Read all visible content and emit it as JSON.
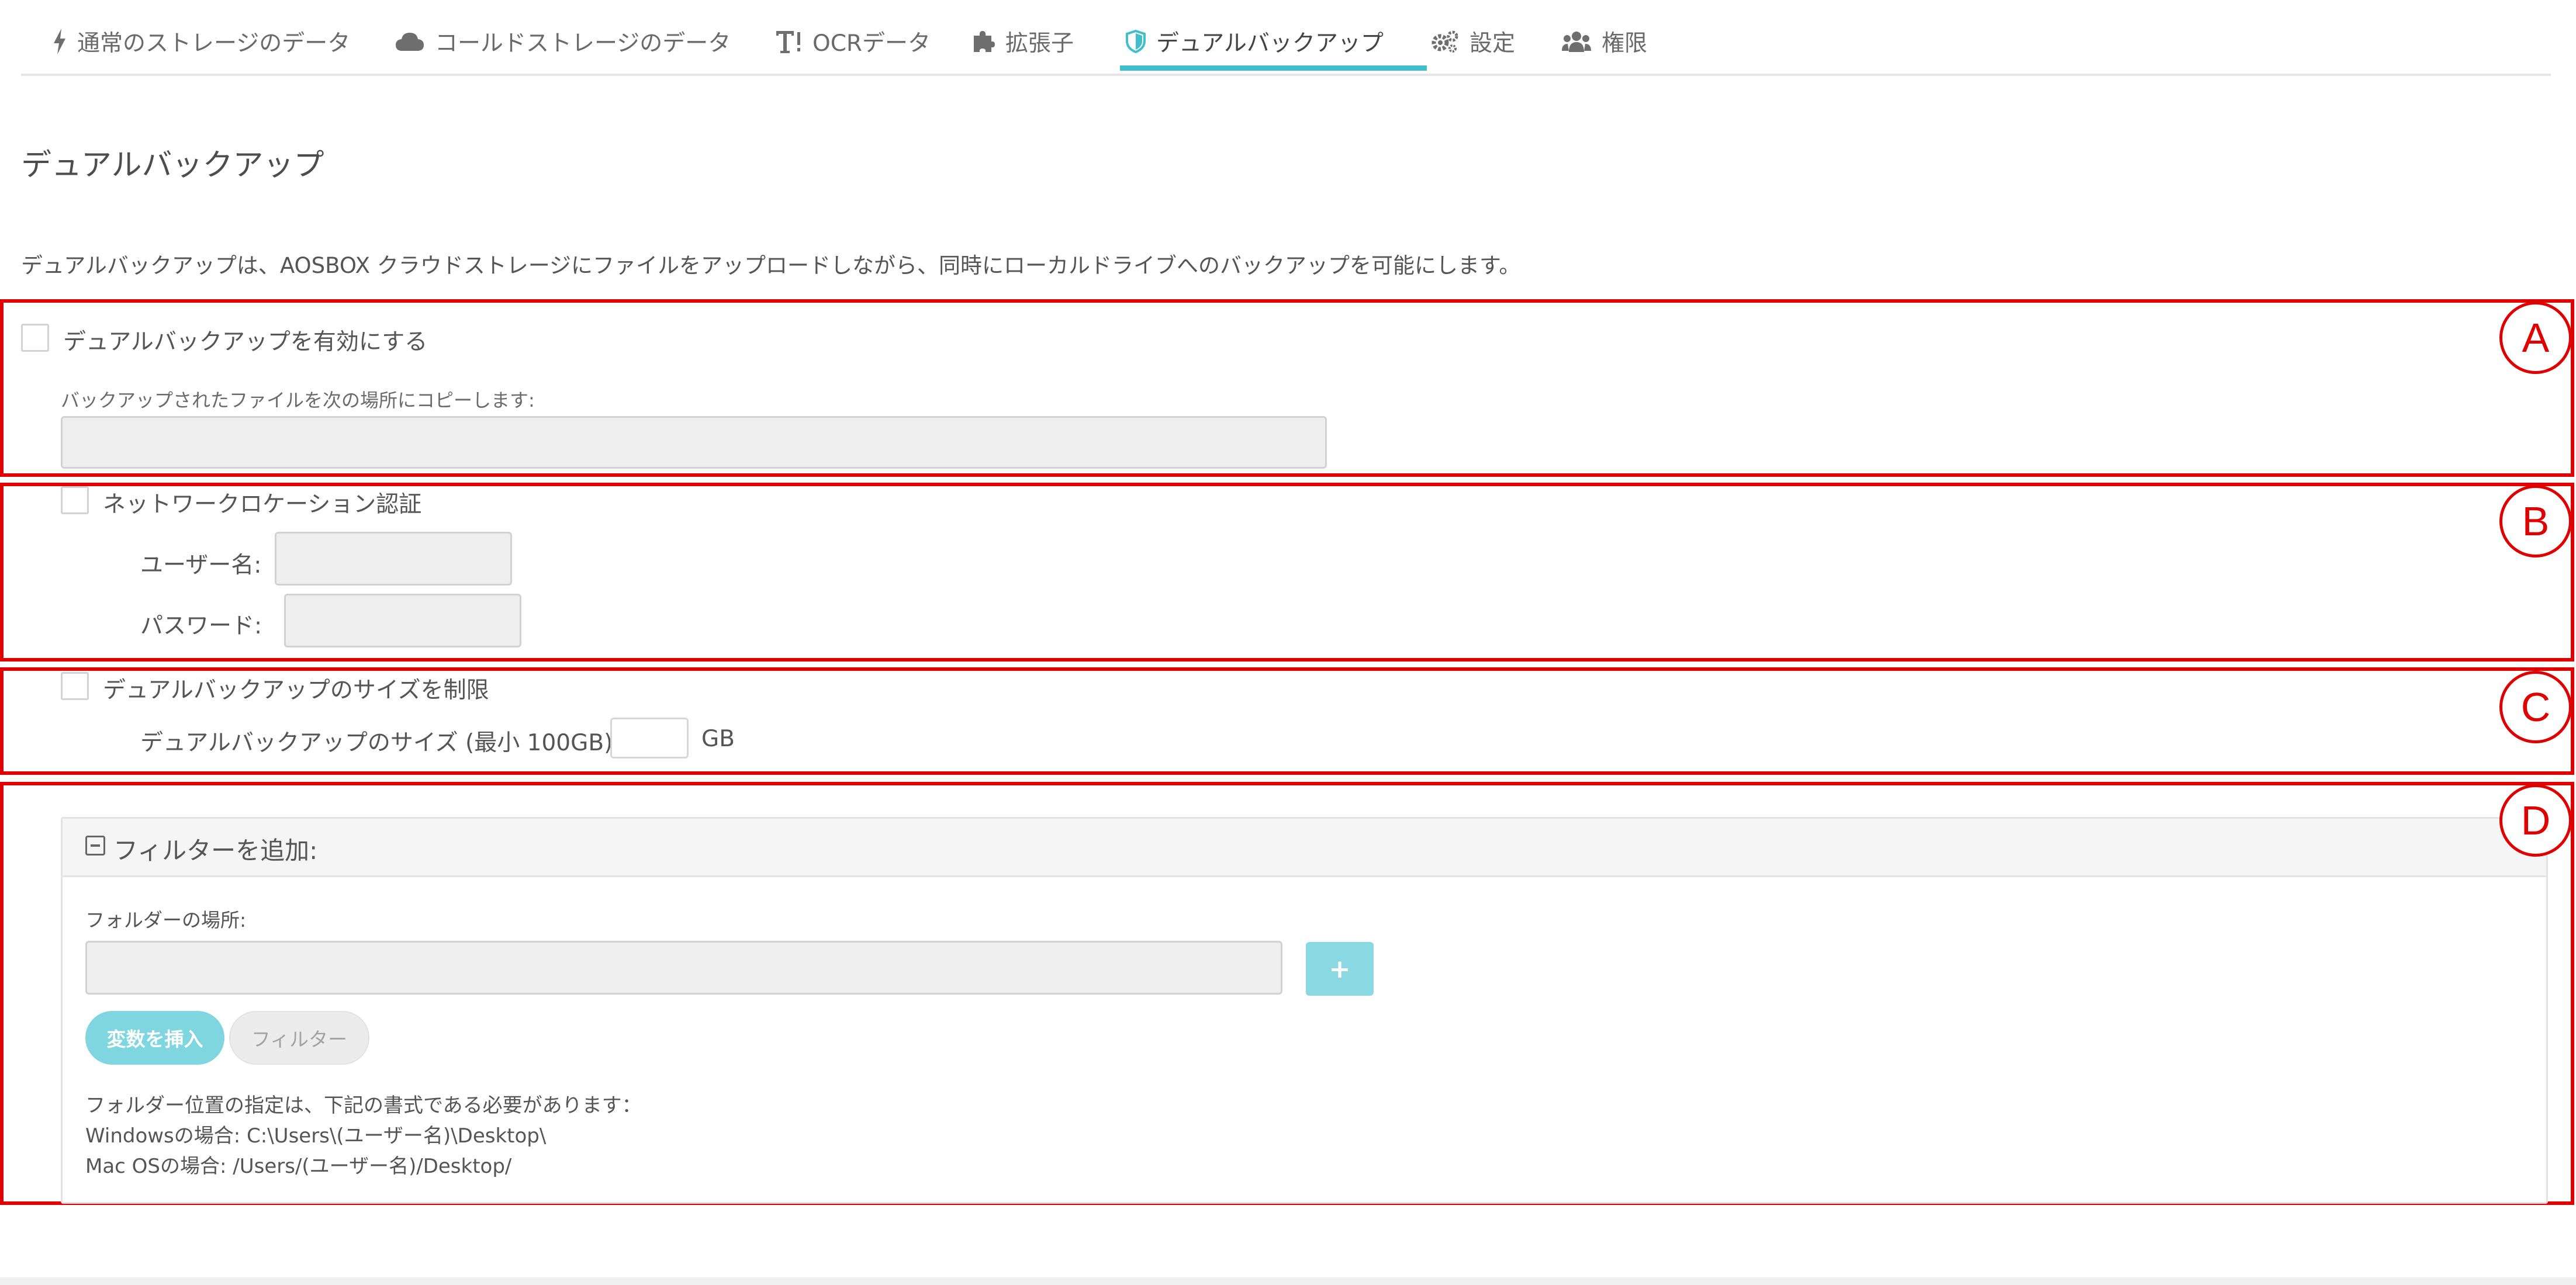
{
  "tabs": [
    {
      "label": "通常のストレージのデータ",
      "icon": "bolt-icon"
    },
    {
      "label": "コールドストレージのデータ",
      "icon": "cloud-icon"
    },
    {
      "label": "OCRデータ",
      "icon": "text-ocr-icon"
    },
    {
      "label": "拡張子",
      "icon": "puzzle-icon"
    },
    {
      "label": "デュアルバックアップ",
      "icon": "shield-icon",
      "active": true
    },
    {
      "label": "設定",
      "icon": "gears-icon"
    },
    {
      "label": "権限",
      "icon": "users-icon"
    }
  ],
  "page": {
    "title": "デュアルバックアップ",
    "description": "デュアルバックアップは、AOSBOX クラウドストレージにファイルをアップロードしながら、同時にローカルドライブへのバックアップを可能にします。"
  },
  "section_a": {
    "marker": "A",
    "enable_label": "デュアルバックアップを有効にする",
    "enable_checked": false,
    "copy_to_label": "バックアップされたファイルを次の場所にコピーします:",
    "copy_to_value": ""
  },
  "section_b": {
    "marker": "B",
    "auth_label": "ネットワークロケーション認証",
    "auth_checked": false,
    "username_label": "ユーザー名:",
    "username_value": "",
    "password_label": "パスワード:",
    "password_value": ""
  },
  "section_c": {
    "marker": "C",
    "limit_label": "デュアルバックアップのサイズを制限",
    "limit_checked": false,
    "size_label": "デュアルバックアップのサイズ (最小 100GB):",
    "size_value": "",
    "size_unit": "GB"
  },
  "section_d": {
    "marker": "D",
    "panel_title": "フィルターを追加:",
    "folder_label": "フォルダーの場所:",
    "folder_value": "",
    "add_button": "+",
    "insert_variable_button": "変数を挿入",
    "filter_button": "フィルター",
    "note_line1": "フォルダー位置の指定は、下記の書式である必要があります：",
    "note_line2": "Windowsの場合: C:\\Users\\(ユーザー名)\\Desktop\\",
    "note_line3": "Mac OSの場合: /Users/(ユーザー名)/Desktop/"
  },
  "colors": {
    "accent": "#3dbfcc",
    "annotation": "#e00000",
    "button_light": "#8ad9e2"
  }
}
